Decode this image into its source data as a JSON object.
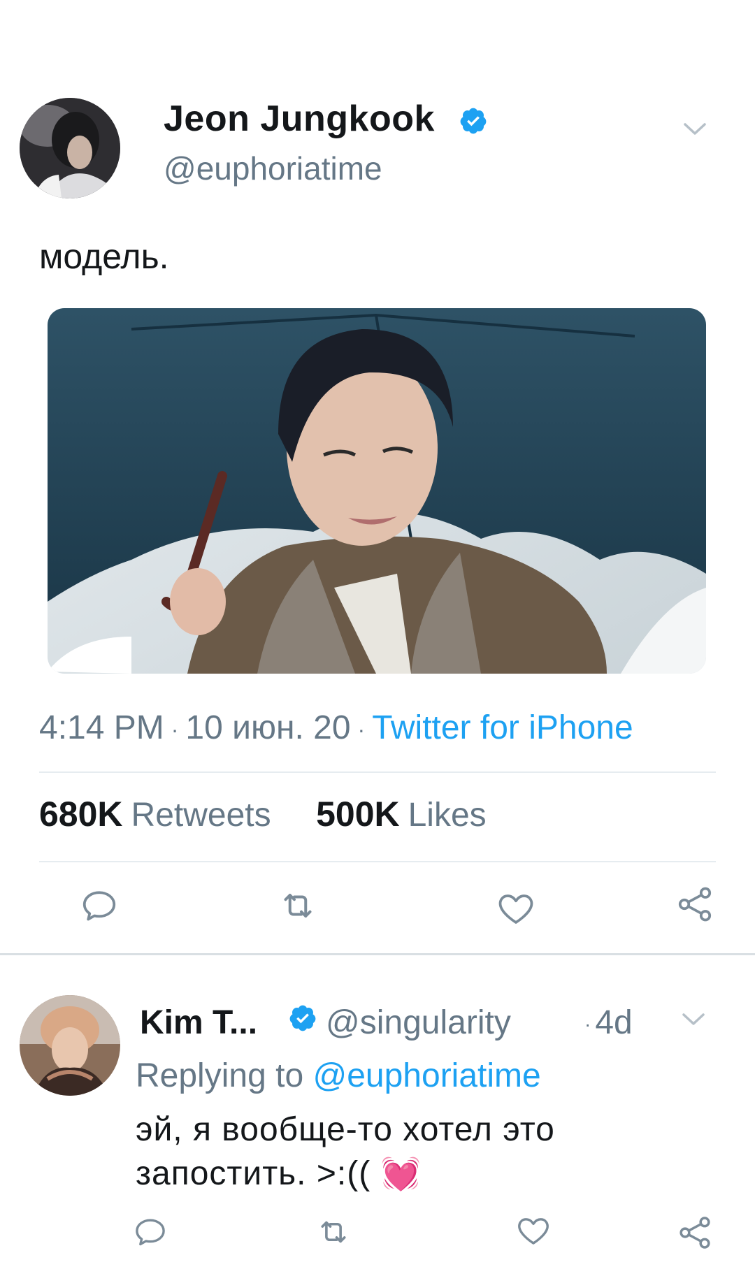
{
  "tweet": {
    "author_name": "Jeon Jungkook",
    "author_handle": "@euphoriatime",
    "text": "модель.",
    "time": "4:14 PM",
    "date": "10 июн. 20",
    "separator": "·",
    "source": "Twitter for iPhone",
    "retweets_count": "680K",
    "retweets_label": "Retweets",
    "likes_count": "500K",
    "likes_label": "Likes"
  },
  "reply": {
    "author_name": "Kim T...",
    "author_handle": "@singularity",
    "separator": "·",
    "time": "4d",
    "replying_prefix": "Replying to",
    "replying_to": "@euphoriatime",
    "text_line1": "эй, я вообще-то хотел это",
    "text_line2": "запостить. >:((",
    "emoji": "💓"
  },
  "icons": {
    "reply": "reply-icon",
    "retweet": "retweet-icon",
    "like": "heart-icon",
    "share": "share-icon",
    "verified": "verified-badge-icon",
    "menu": "chevron-down-icon"
  },
  "colors": {
    "accent": "#1da1f2",
    "secondary_text": "#657786",
    "primary_text": "#14171a",
    "divider": "#e6ecf0",
    "icon": "#7b8b98"
  }
}
